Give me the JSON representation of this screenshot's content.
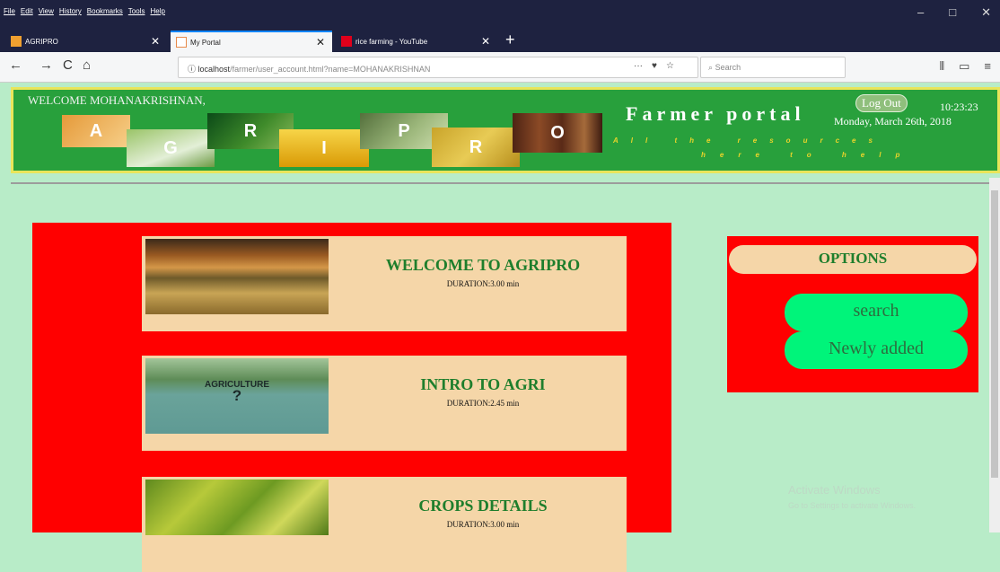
{
  "browser": {
    "menu": [
      "File",
      "Edit",
      "View",
      "History",
      "Bookmarks",
      "Tools",
      "Help"
    ],
    "window_controls": [
      "–",
      "□",
      "✕"
    ],
    "tabs": [
      {
        "label": "AGRIPRO",
        "close": "✕"
      },
      {
        "label": "My Portal",
        "close": "✕"
      },
      {
        "label": "rice farming - YouTube",
        "close": "✕"
      }
    ],
    "new_tab": "+",
    "nav": {
      "back": "←",
      "forward": "→",
      "reload": "C",
      "home": "⌂"
    },
    "url_host": "localhost",
    "url_path": "/farmer/user_account.html?name=MOHANAKRISHNAN",
    "url_icons": [
      "···",
      "♥",
      "☆"
    ],
    "search_placeholder": "Search",
    "toolbar_right": [
      "⫴",
      "▭",
      "≡"
    ]
  },
  "header": {
    "welcome": "WELCOME MOHANAKRISHNAN,",
    "logo_letters": [
      "A",
      "G",
      "R",
      "I",
      "P",
      "R",
      "O"
    ],
    "portal_title": "Farmer portal",
    "tagline_1": "All the resources",
    "tagline_2": "here to help",
    "logout": "Log Out",
    "time": "10:23:23",
    "date": "Monday, March 26th, 2018"
  },
  "courses": [
    {
      "title": "WELCOME TO AGRIPRO",
      "duration": "DURATION:3.00 min"
    },
    {
      "title": "INTRO TO AGRI",
      "duration": "DURATION:2.45 min",
      "thumb_text": "AGRICULTURE",
      "thumb_mark": "?"
    },
    {
      "title": "CROPS DETAILS",
      "duration": "DURATION:3.00 min"
    }
  ],
  "options": {
    "title": "OPTIONS",
    "search": "search",
    "newly_added": "Newly added"
  },
  "watermark": {
    "line1": "Activate Windows",
    "line2": "Go to Settings to activate Windows."
  },
  "colors": {
    "header_green": "#28a03c",
    "panel_red": "#ff0000",
    "card_beige": "#f5d6a8",
    "title_green": "#1e7e2c",
    "button_green": "#00f47a",
    "page_bg": "#b8ecc8"
  }
}
